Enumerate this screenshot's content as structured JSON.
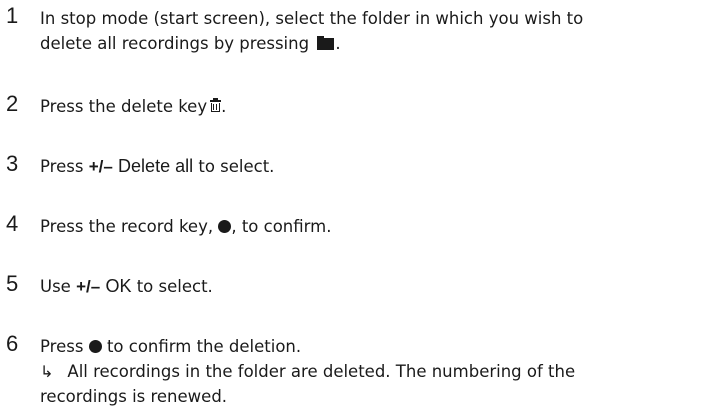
{
  "steps": [
    {
      "number": "1",
      "line1": "In stop mode (start screen), select the folder in which you wish to",
      "line2": "delete all recordings by pressing",
      "line2_end": ".",
      "icon": "folder-icon"
    },
    {
      "number": "2",
      "text": "Press the delete key",
      "text_end": ".",
      "icon": "trash-icon"
    },
    {
      "number": "3",
      "text_pre": "Press",
      "key": "+/–",
      "display": "Delete all",
      "text_post": "to select."
    },
    {
      "number": "4",
      "text_pre": "Press the record key,",
      "text_post": ", to confirm.",
      "icon": "record-dot-icon"
    },
    {
      "number": "5",
      "text_pre": "Use",
      "key": "+/–",
      "display": "OK",
      "text_post": "to select."
    },
    {
      "number": "6",
      "text_pre": "Press",
      "text_post": "to confirm the deletion.",
      "icon": "record-dot-icon",
      "result_arrow": "↳",
      "result_line1": "All recordings in the folder are deleted. The numbering of the",
      "result_line2": "recordings is renewed."
    }
  ]
}
